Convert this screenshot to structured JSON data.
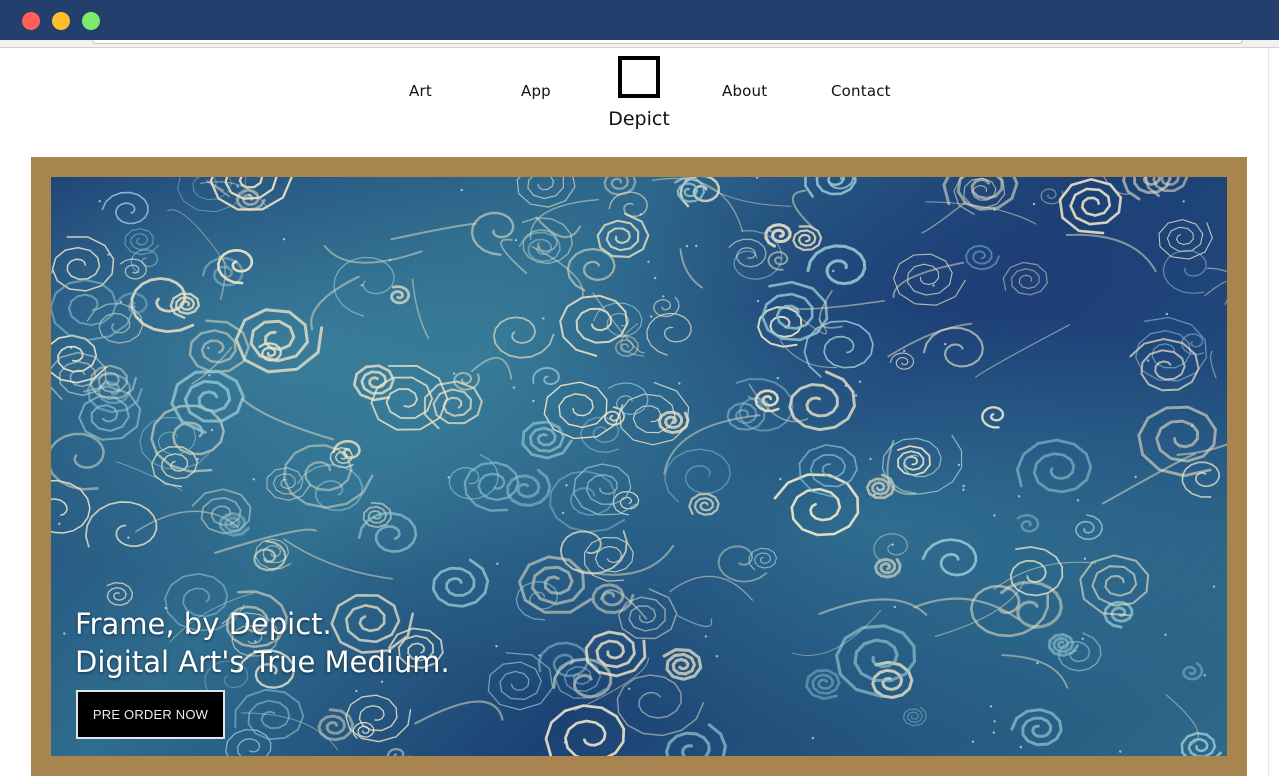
{
  "window": {
    "controls": {
      "close_color": "#ff6159",
      "minimize_color": "#ffbd2e",
      "zoom_color": "#7ceb6a"
    },
    "titlebar_color": "#233f6e"
  },
  "nav": {
    "items": [
      {
        "label": "Art"
      },
      {
        "label": "App"
      },
      {
        "label": "About"
      },
      {
        "label": "Contact"
      }
    ],
    "logo": {
      "label": "Depict",
      "icon": "square-outline-icon"
    }
  },
  "hero": {
    "frame_color": "#a8844f",
    "artwork_description_icon": "swirling-waves-artwork",
    "headline_line1": "Frame, by Depict.",
    "headline_line2": "Digital Art's True Medium.",
    "cta_label": "PRE ORDER NOW"
  }
}
